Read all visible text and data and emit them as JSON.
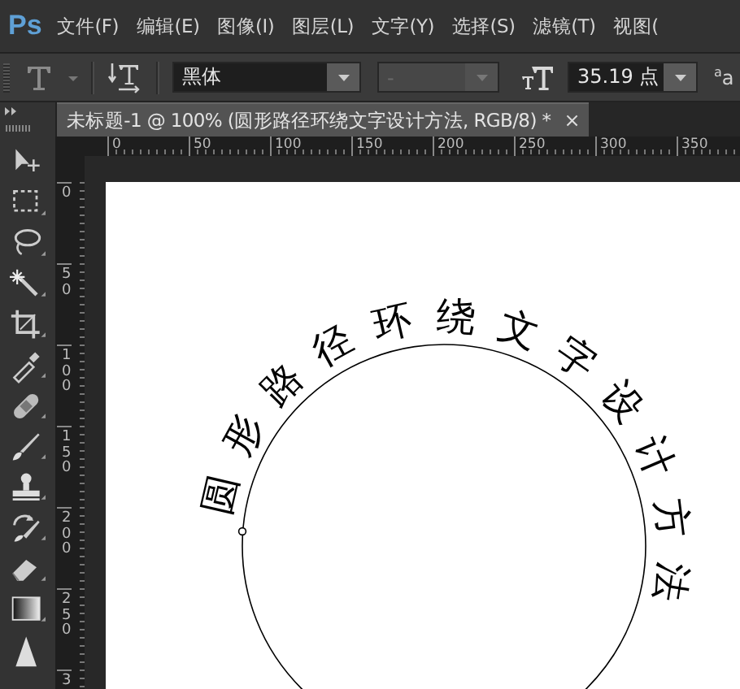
{
  "app": {
    "logo": "Ps"
  },
  "menu": [
    "文件(F)",
    "编辑(E)",
    "图像(I)",
    "图层(L)",
    "文字(Y)",
    "选择(S)",
    "滤镜(T)",
    "视图("
  ],
  "options": {
    "font_family": "黑体",
    "font_style": "-",
    "font_size": "35.19 点",
    "antialias": "$^{a}$a"
  },
  "document_tab": {
    "title": "未标题-1 @ 100% (圆形路径环绕文字设计方法, RGB/8) *",
    "close": "×"
  },
  "ruler_horizontal": [
    "0",
    "50",
    "100",
    "150",
    "200",
    "250",
    "300",
    "350"
  ],
  "ruler_vertical": [
    "0",
    "50",
    "100",
    "150",
    "200",
    "250",
    "3"
  ],
  "canvas": {
    "path_text": "圆形路径环绕文字设计方法"
  }
}
